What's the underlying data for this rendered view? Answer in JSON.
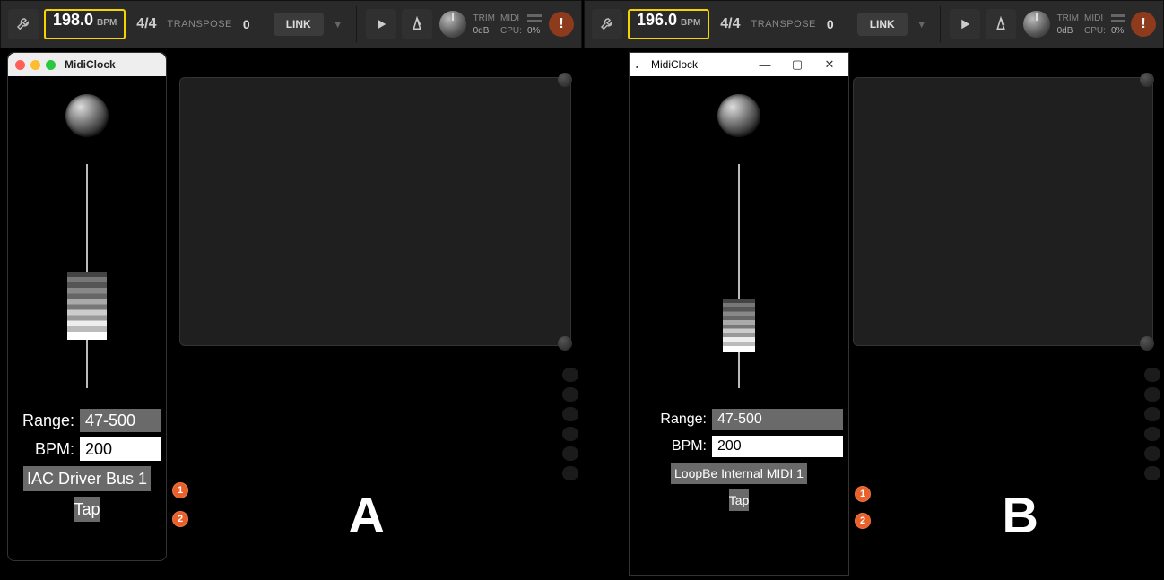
{
  "panels": {
    "a": {
      "letter": "A",
      "toolbar": {
        "bpm": "198.0",
        "bpm_label": "BPM",
        "time_sig": "4/4",
        "transpose_label": "TRANSPOSE",
        "transpose_value": "0",
        "link_label": "LINK",
        "trim_label": "TRIM",
        "trim_value": "0dB",
        "midi_label": "MIDI",
        "cpu_label": "CPU:",
        "cpu_value": "0%"
      },
      "midiclock": {
        "title": "MidiClock",
        "range_label": "Range:",
        "range_value": "47-500",
        "bpm_label": "BPM:",
        "bpm_value": "200",
        "driver": "IAC Driver Bus 1",
        "tap_label": "Tap"
      },
      "callouts": {
        "one": "1",
        "two": "2"
      }
    },
    "b": {
      "letter": "B",
      "toolbar": {
        "bpm": "196.0",
        "bpm_label": "BPM",
        "time_sig": "4/4",
        "transpose_label": "TRANSPOSE",
        "transpose_value": "0",
        "link_label": "LINK",
        "trim_label": "TRIM",
        "trim_value": "0dB",
        "midi_label": "MIDI",
        "cpu_label": "CPU:",
        "cpu_value": "0%"
      },
      "midiclock": {
        "title": "MidiClock",
        "range_label": "Range:",
        "range_value": "47-500",
        "bpm_label": "BPM:",
        "bpm_value": "200",
        "driver": "LoopBe Internal MIDI 1",
        "tap_label": "Tap",
        "win_minimize": "—",
        "win_maximize": "▢",
        "win_close": "✕"
      },
      "callouts": {
        "one": "1",
        "two": "2"
      }
    }
  }
}
